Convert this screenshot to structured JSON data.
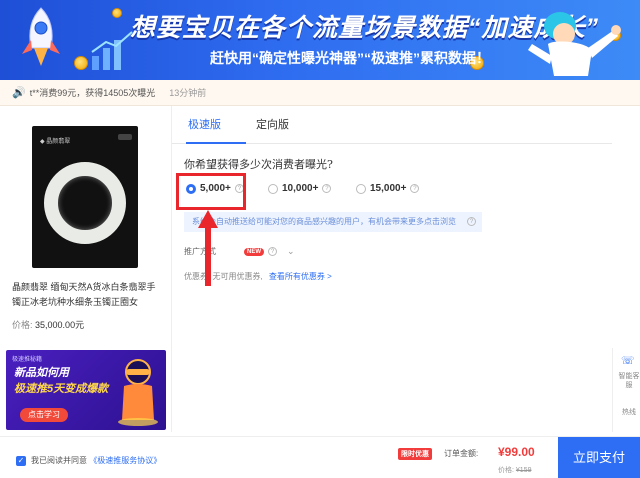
{
  "banner": {
    "title": "想要宝贝在各个流量场景数据“加速成长”",
    "subtitle": "赶快用“确定性曝光神器”“极速推”累积数据！"
  },
  "notice": {
    "message": "t**消费99元，获得14505次曝光",
    "time": "13分钟前"
  },
  "product": {
    "title": "晶颜翡翠 缅甸天然A货冰白条翡翠手镯正冰老坑种水细条玉镯正圈女",
    "price_label": "价格:",
    "price_value": "35,000.00元"
  },
  "ad": {
    "tag": "极速推秘籍",
    "line1": "新品如何用",
    "line2": "极速推5天变成爆款",
    "button": "点击学习"
  },
  "tabs": [
    {
      "label": "极速版",
      "active": true
    },
    {
      "label": "定向版",
      "active": false
    }
  ],
  "question": "你希望获得多少次消费者曝光?",
  "options": [
    {
      "label": "5,000+",
      "selected": true
    },
    {
      "label": "10,000+",
      "selected": false
    },
    {
      "label": "15,000+",
      "selected": false
    }
  ],
  "info_text": "系统会自动推送给可能对您的商品感兴趣的用户，有机会带来更多点击浏览",
  "promo": {
    "label": "推广方式",
    "new_tag": "NEW"
  },
  "coupon": {
    "label": "优惠券: 无可用优惠券,",
    "link": "查看所有优惠券 >"
  },
  "sidebar": {
    "service_label": "智能客服",
    "hot_label": "热线"
  },
  "footer": {
    "agree_text": "我已阅读并同意",
    "agreement_link": "《极速推服务协议》",
    "limit_tag": "限时优惠",
    "order_label": "订单金额:",
    "amount": "¥99.00",
    "orig_label": "价格:",
    "orig_price": "¥159",
    "pay_button": "立即支付"
  },
  "colors": {
    "accent": "#2d6ef5",
    "highlight": "#e8262c",
    "price": "#f23b3b"
  }
}
